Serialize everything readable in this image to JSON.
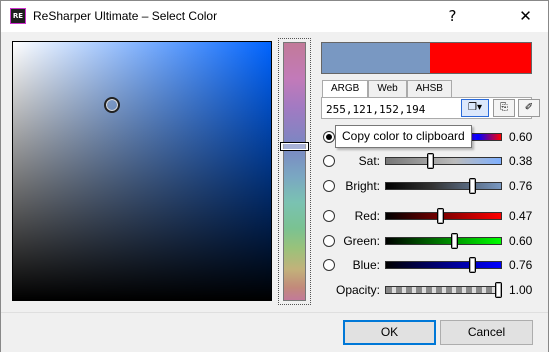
{
  "window": {
    "title": "ReSharper Ultimate – Select Color",
    "app_icon": "RE",
    "help_label": "?",
    "close_label": "✕"
  },
  "colors": {
    "selected_hex": "#7998C2",
    "current_hex": "#FF0000"
  },
  "tabs": [
    {
      "label": "ARGB",
      "active": true
    },
    {
      "label": "Web",
      "active": false
    },
    {
      "label": "AHSB",
      "active": false
    }
  ],
  "value": "255,121,152,194",
  "toolbar": {
    "copy_icon": "copy-dropdown-icon",
    "paste_icon": "paste-icon",
    "eyedropper_icon": "eyedropper-icon"
  },
  "tooltip": "Copy color to clipboard",
  "sliders": [
    {
      "label": "",
      "value": "0.60",
      "fraction": 0.6,
      "checked": true
    },
    {
      "label": "Sat:",
      "value": "0.38",
      "fraction": 0.38,
      "checked": false
    },
    {
      "label": "Bright:",
      "value": "0.76",
      "fraction": 0.76,
      "checked": false
    },
    {
      "label": "Red:",
      "value": "0.47",
      "fraction": 0.47,
      "checked": false
    },
    {
      "label": "Green:",
      "value": "0.60",
      "fraction": 0.6,
      "checked": false
    },
    {
      "label": "Blue:",
      "value": "0.76",
      "fraction": 0.76,
      "checked": false
    },
    {
      "label": "Opacity:",
      "value": "1.00",
      "fraction": 1.0,
      "checked": false
    }
  ],
  "buttons": {
    "ok": "OK",
    "cancel": "Cancel"
  }
}
